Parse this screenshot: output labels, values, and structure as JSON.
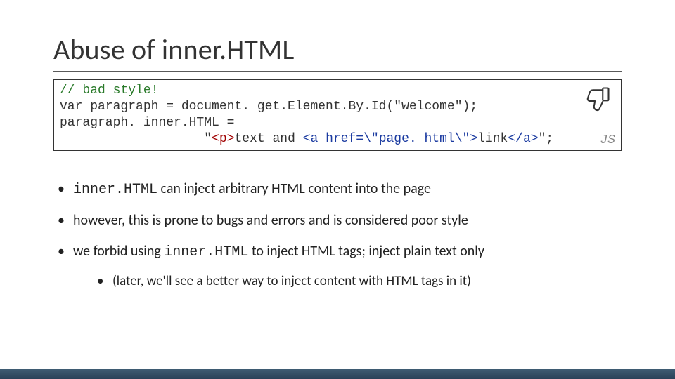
{
  "title": "Abuse of inner.HTML",
  "code": {
    "comment": "// bad style!",
    "line2": "var paragraph = document. get.Element.By.Id(\"welcome\");",
    "line3": "paragraph. inner.HTML =",
    "line4_indent": "                   \"",
    "line4_p_open": "<p>",
    "line4_mid1": "text and ",
    "line4_a_open": "<a href=\\\"page. html\\\">",
    "line4_mid2": "link",
    "line4_a_close": "</a>",
    "line4_tail": "\";",
    "lang_badge": "JS"
  },
  "bullets": [
    {
      "pre_code": "inner.HTML",
      "text_after": " can inject arbitrary HTML content into the page"
    },
    {
      "text": "however, this is prone to bugs and errors and is considered poor style"
    },
    {
      "text_before": "we forbid using ",
      "code": "inner.HTML",
      "text_after": " to inject HTML tags; inject plain text only",
      "sub": "(later, we'll see a better way to inject content with HTML tags in it)"
    }
  ]
}
